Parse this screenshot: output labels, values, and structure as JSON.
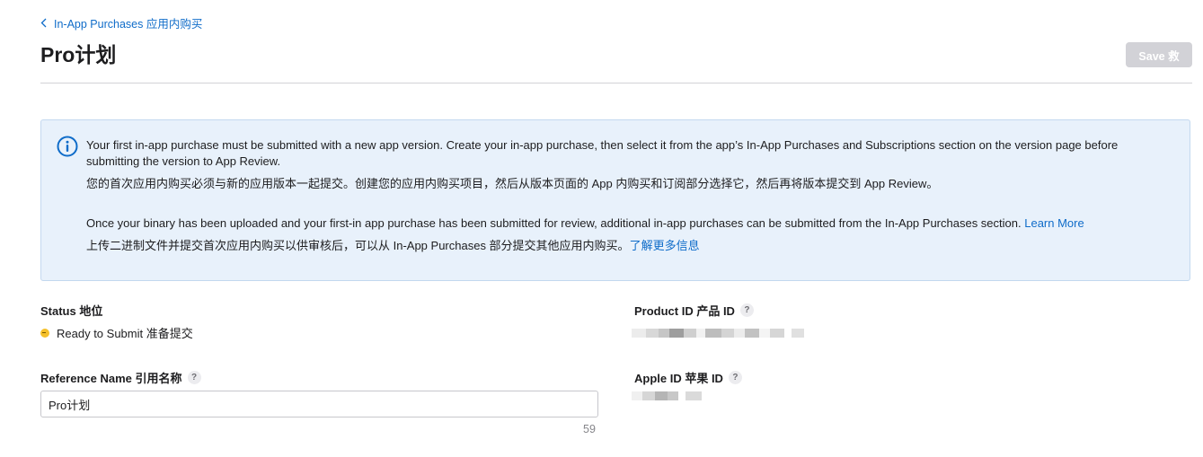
{
  "breadcrumb": {
    "label": "In-App Purchases  应用内购买"
  },
  "page": {
    "title": "Pro计划"
  },
  "toolbar": {
    "save_label": "Save  救"
  },
  "info": {
    "line1_en": "Your first in-app purchase must be submitted with a new app version. Create your in-app purchase, then select it from the app’s In-App Purchases and Subscriptions section on the version page before submitting the version to App Review.",
    "line1_zh": "您的首次应用内购买必须与新的应用版本一起提交。创建您的应用内购买项目，然后从版本页面的 App 内购买和订阅部分选择它，然后再将版本提交到 App Review。",
    "line2_en": "Once your binary has been uploaded and your first-in app purchase has been submitted for review, additional in-app purchases can be submitted from the In-App Purchases section.",
    "learn_more_en": "Learn More",
    "line2_zh": "上传二进制文件并提交首次应用内购买以供审核后，可以从 In-App Purchases 部分提交其他应用内购买。",
    "learn_more_zh": "了解更多信息"
  },
  "status": {
    "label": "Status  地位",
    "value": "Ready to Submit  准备提交",
    "dot_color": "#f5c02a"
  },
  "product_id": {
    "label": "Product ID  产品 ID",
    "help": "?"
  },
  "reference_name": {
    "label": "Reference Name  引用名称",
    "help": "?",
    "value": "Pro计划",
    "remaining": "59"
  },
  "apple_id": {
    "label": "Apple ID  苹果 ID",
    "help": "?"
  },
  "colors": {
    "accent": "#0f6cc9",
    "info_bg": "#e8f1fb",
    "save_disabled": "#d2d2d7"
  }
}
